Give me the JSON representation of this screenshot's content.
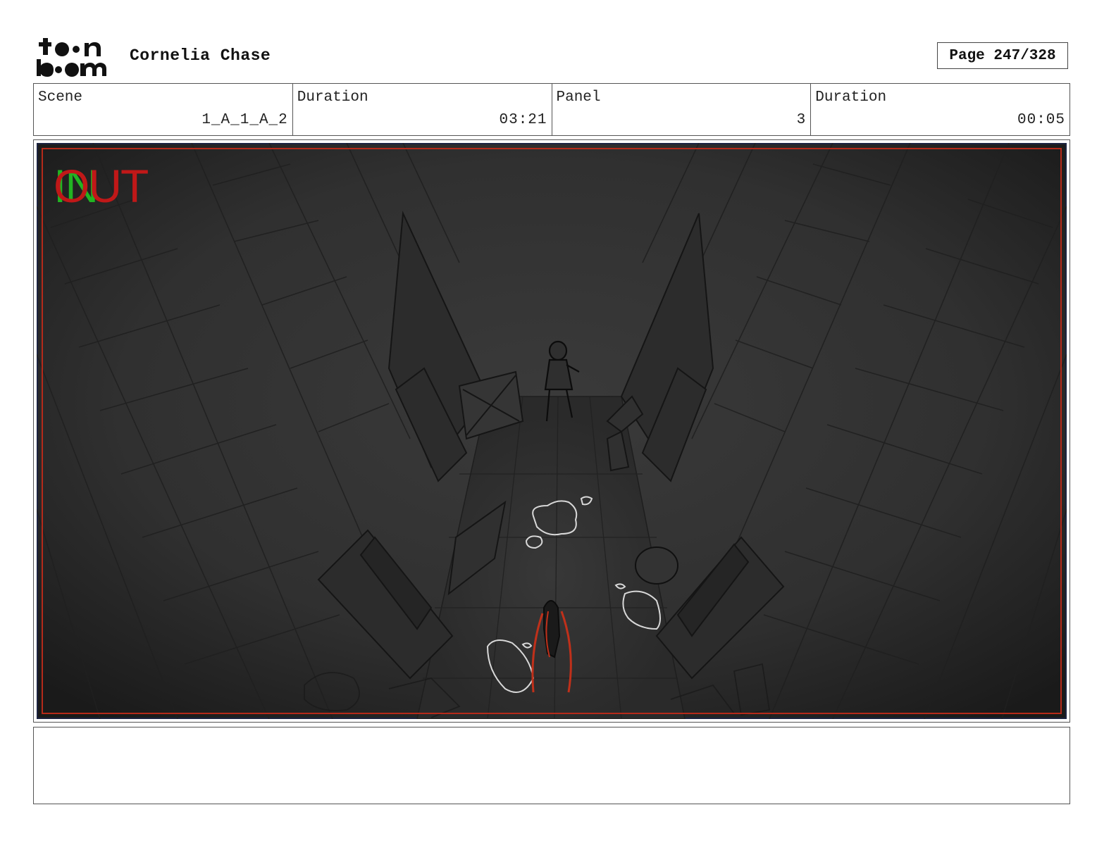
{
  "header": {
    "logo_text": "toon boom",
    "project_title": "Cornelia Chase",
    "page_label": "Page 247/328"
  },
  "info": {
    "scene_label": "Scene",
    "scene_value": "1_A_1_A_2",
    "scene_duration_label": "Duration",
    "scene_duration_value": "03:21",
    "panel_label": "Panel",
    "panel_value": "3",
    "panel_duration_label": "Duration",
    "panel_duration_value": "00:05"
  },
  "panel": {
    "in_marker": "IN",
    "out_marker": "OUT",
    "in_color": "#22b422",
    "out_color": "#c01818",
    "safe_frame_color": "#b52a1a"
  },
  "notes": {
    "text": ""
  }
}
